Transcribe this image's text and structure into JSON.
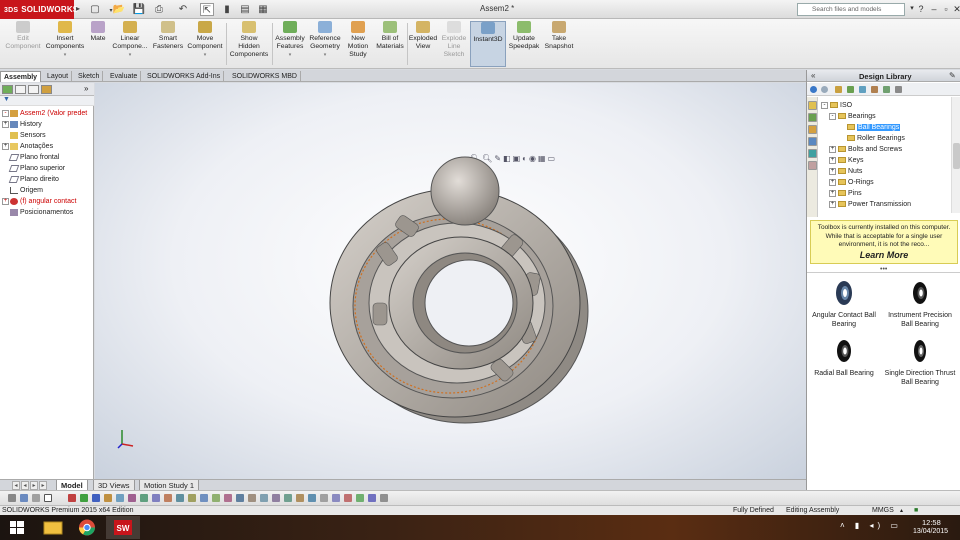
{
  "titlebar": {
    "brand_prefix": "3DS",
    "brand": "SOLIDWORKS",
    "doc_title": "Assem2 *",
    "search_placeholder": "Search files and models",
    "help_label": "?"
  },
  "command_manager": [
    {
      "label": "Edit\nComponent",
      "disabled": true
    },
    {
      "label": "Insert\nComponents"
    },
    {
      "label": "Mate"
    },
    {
      "label": "Linear\nCompone..."
    },
    {
      "label": "Smart\nFasteners"
    },
    {
      "label": "Move\nComponent"
    },
    {
      "label": "Show\nHidden\nComponents"
    },
    {
      "label": "Assembly\nFeatures"
    },
    {
      "label": "Reference\nGeometry"
    },
    {
      "label": "New\nMotion\nStudy"
    },
    {
      "label": "Bill of\nMaterials"
    },
    {
      "label": "Exploded\nView"
    },
    {
      "label": "Explode\nLine\nSketch",
      "disabled": true
    },
    {
      "label": "Instant3D",
      "active": true
    },
    {
      "label": "Update\nSpeedpak"
    },
    {
      "label": "Take\nSnapshot"
    }
  ],
  "tabs": [
    "Assembly",
    "Layout",
    "Sketch",
    "Evaluate",
    "SOLIDWORKS Add-Ins",
    "SOLIDWORKS MBD"
  ],
  "feature_tree": [
    {
      "label": "Assem2  (Valor predet",
      "red": true,
      "expand": true
    },
    {
      "label": "History",
      "expand": true
    },
    {
      "label": "Sensors"
    },
    {
      "label": "Anotações",
      "expand": true
    },
    {
      "label": "Plano frontal"
    },
    {
      "label": "Plano superior"
    },
    {
      "label": "Plano direito"
    },
    {
      "label": "Origem"
    },
    {
      "label": "(f) angular contact",
      "red": true,
      "expand": true
    },
    {
      "label": "Posicionamentos"
    }
  ],
  "bottom_tabs": [
    "Model",
    "3D Views",
    "Motion Study 1"
  ],
  "status": {
    "app": "SOLIDWORKS Premium 2015 x64 Edition",
    "state": "Fully Defined",
    "mode": "Editing Assembly",
    "units": "MMGS"
  },
  "clock": {
    "time": "12:58",
    "date": "13/04/2015"
  },
  "design_library": {
    "title": "Design Library",
    "tree": [
      {
        "label": "ISO",
        "level": 0,
        "expand": "-"
      },
      {
        "label": "Bearings",
        "level": 1,
        "expand": "-"
      },
      {
        "label": "Ball Bearings",
        "level": 2,
        "selected": true
      },
      {
        "label": "Roller Bearings",
        "level": 2
      },
      {
        "label": "Bolts and Screws",
        "level": 1,
        "expand": "+"
      },
      {
        "label": "Keys",
        "level": 1,
        "expand": "+"
      },
      {
        "label": "Nuts",
        "level": 1,
        "expand": "+"
      },
      {
        "label": "O-Rings",
        "level": 1,
        "expand": "+"
      },
      {
        "label": "Pins",
        "level": 1,
        "expand": "+"
      },
      {
        "label": "Power Transmission",
        "level": 1,
        "expand": "+"
      }
    ],
    "notice_text": "Toolbox is currently installed on this computer. While that is acceptable for a single user environment, it is not the reco...",
    "learn_more": "Learn More",
    "parts": [
      {
        "label": "Angular Contact Ball Bearing"
      },
      {
        "label": "Instrument Precision Ball Bearing"
      },
      {
        "label": "Radial Ball Bearing"
      },
      {
        "label": "Single Direction Thrust Ball Bearing"
      }
    ]
  },
  "colors": {
    "brand_red": "#c8151b",
    "selection_blue": "#3399ff",
    "notice_yellow": "#fffbb8",
    "part_grey": "#b9b4ae"
  }
}
